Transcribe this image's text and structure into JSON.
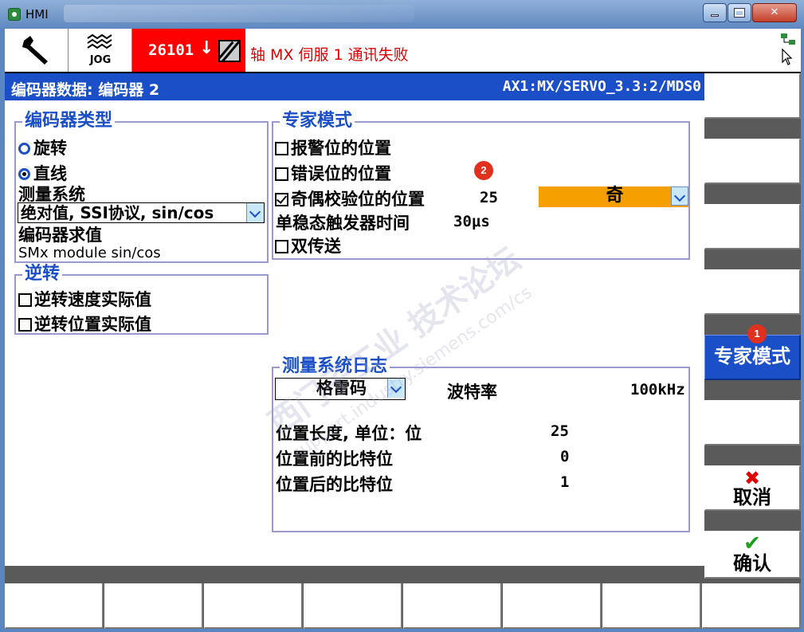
{
  "window": {
    "title": "HMI"
  },
  "topbar": {
    "jog_label": "JOG",
    "alarm_number": "26101",
    "alarm_arrow": "↓",
    "alarm_message": "轴 MX 伺服 1 通讯失败"
  },
  "header": {
    "title": "编码器数据: 编码器 2",
    "path": "AX1:MX/SERVO_3.3:2/MDS0"
  },
  "encoder_type": {
    "legend": "编码器类型",
    "rotary": "旋转",
    "linear": "直线",
    "selected": "直线",
    "measuring_system_label": "测量系统",
    "measuring_system_value": "绝对值, SSI协议, sin/cos",
    "evaluation_label": "编码器求值",
    "evaluation_value": "SMx module sin/cos"
  },
  "inversion": {
    "legend": "逆转",
    "speed": "逆转速度实际值",
    "speed_checked": false,
    "position": "逆转位置实际值",
    "position_checked": false
  },
  "expert": {
    "legend": "专家模式",
    "alarm_bit": "报警位的位置",
    "alarm_bit_checked": false,
    "error_bit": "错误位的位置",
    "error_bit_checked": false,
    "parity_bit": "奇偶校验位的位置",
    "parity_bit_checked": true,
    "parity_value": "25",
    "parity_mode": "奇",
    "monoflop_label": "单稳态触发器时间",
    "monoflop_value": "30μs",
    "double_transmit": "双传送",
    "double_transmit_checked": false
  },
  "log": {
    "legend": "测量系统日志",
    "code": "格雷码",
    "baud_label": "波特率",
    "baud_value": "100kHz",
    "pos_length_label": "位置长度, 单位：位",
    "pos_length_value": "25",
    "bits_before_label": "位置前的比特位",
    "bits_before_value": "0",
    "bits_after_label": "位置后的比特位",
    "bits_after_value": "1"
  },
  "softkeys": {
    "expert_mode": "专家模式",
    "cancel": "取消",
    "ok": "确认"
  },
  "badges": {
    "one": "1",
    "two": "2"
  },
  "watermark": {
    "line1": "西门子工业 技术论坛",
    "line2": "support.industry.siemens.com/cs"
  },
  "colors": {
    "header_blue": "#1a4fc8",
    "alarm_red": "#ff0000",
    "orange": "#f5a000"
  }
}
